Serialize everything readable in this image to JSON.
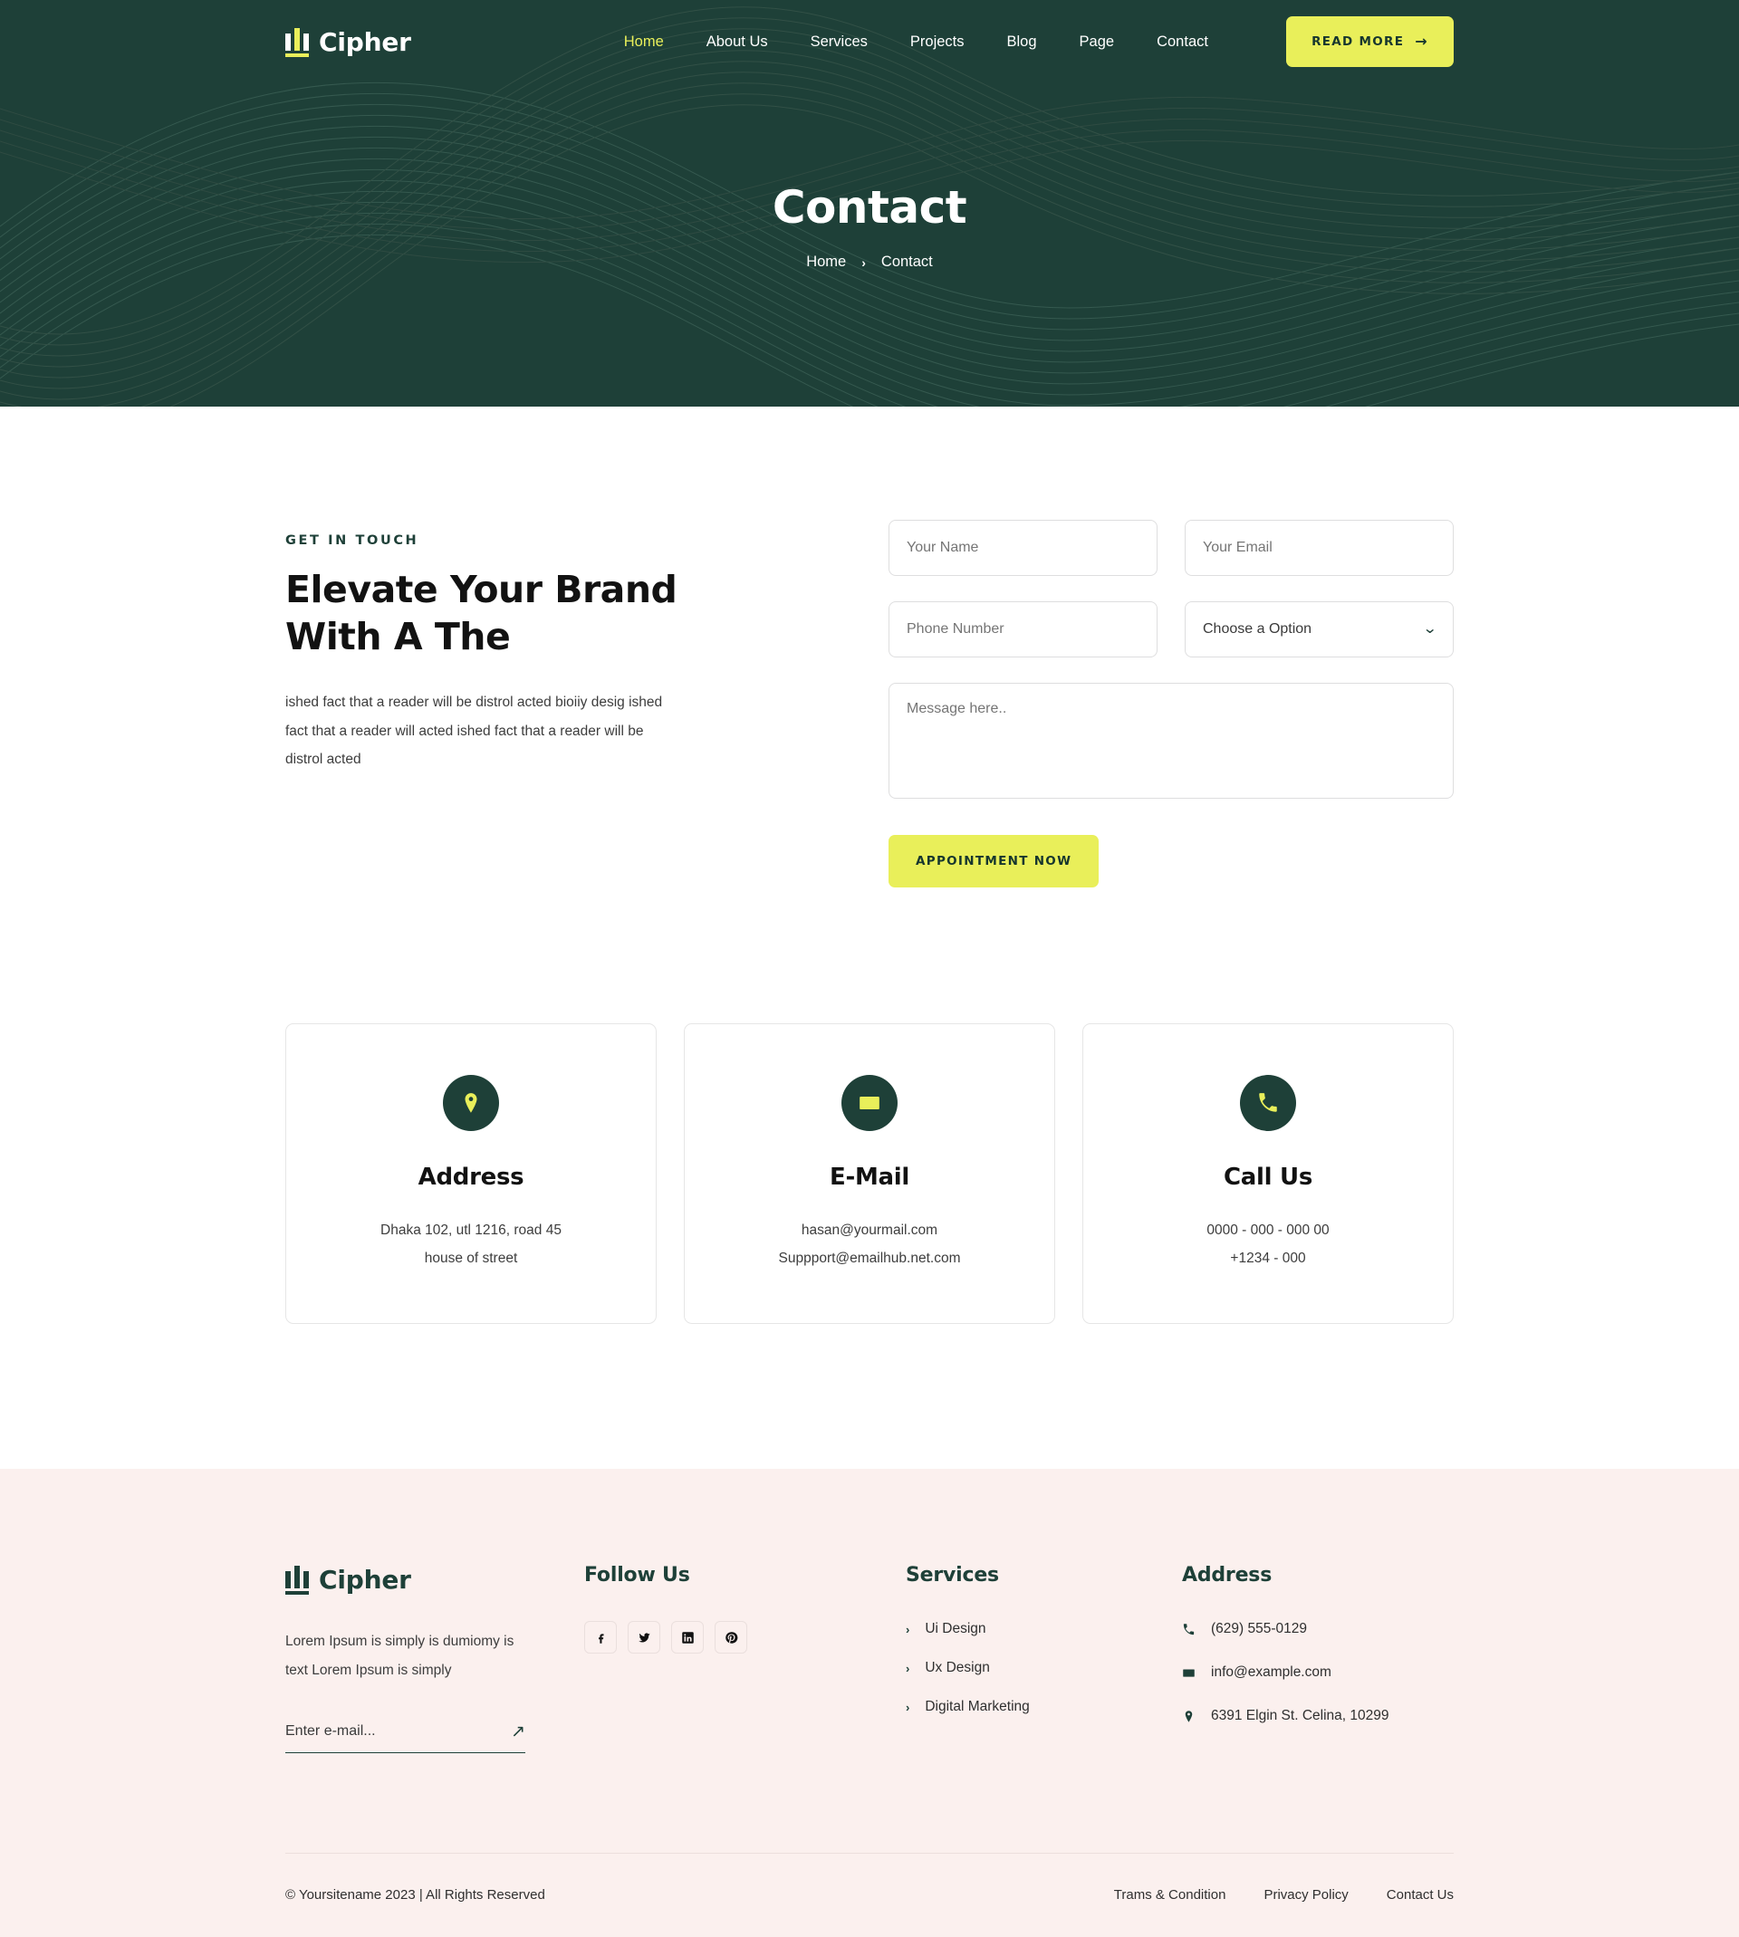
{
  "brand": {
    "name": "Cipher",
    "logo_icon": "bars-logo-icon"
  },
  "nav": {
    "items": [
      {
        "label": "Home",
        "active": true
      },
      {
        "label": "About Us",
        "active": false
      },
      {
        "label": "Services",
        "active": false
      },
      {
        "label": "Projects",
        "active": false
      },
      {
        "label": "Blog",
        "active": false
      },
      {
        "label": "Page",
        "active": false
      },
      {
        "label": "Contact",
        "active": false
      }
    ],
    "cta_label": "READ MORE",
    "cta_icon": "arrow-right-icon"
  },
  "hero": {
    "title": "Contact",
    "breadcrumb": {
      "home": "Home",
      "separator": "›",
      "current": "Contact"
    }
  },
  "contact": {
    "eyebrow": "GET IN TOUCH",
    "title_line1": "Elevate Your Brand",
    "title_line2": "With A The",
    "description": "ished fact that a reader will be distrol acted bioiiy desig ished fact that a reader will acted ished fact that a reader will be distrol acted",
    "form": {
      "name_placeholder": "Your Name",
      "email_placeholder": "Your Email",
      "phone_placeholder": "Phone Number",
      "option_label": "Choose a Option",
      "option_icon": "chevron-down-icon",
      "message_placeholder": "Message here..",
      "submit_label": "APPOINTMENT NOW"
    }
  },
  "info_cards": [
    {
      "icon": "location-pin-icon",
      "title": "Address",
      "lines": [
        "Dhaka 102, utl 1216, road 45",
        "house of street"
      ]
    },
    {
      "icon": "envelope-icon",
      "title": "E-Mail",
      "lines": [
        "hasan@yourmail.com",
        "Suppport@emailhub.net.com"
      ]
    },
    {
      "icon": "phone-icon",
      "title": "Call Us",
      "lines": [
        "0000 - 000 - 000 00",
        "+1234 - 000"
      ]
    }
  ],
  "footer": {
    "brand_name": "Cipher",
    "description": "Lorem Ipsum is simply is dumiomy is text Lorem Ipsum is simply",
    "newsletter": {
      "placeholder": "Enter e-mail...",
      "submit_icon": "arrow-up-right-icon"
    },
    "follow": {
      "title": "Follow Us",
      "socials": [
        {
          "icon": "facebook-icon",
          "name": "Facebook"
        },
        {
          "icon": "twitter-icon",
          "name": "Twitter"
        },
        {
          "icon": "linkedin-icon",
          "name": "LinkedIn"
        },
        {
          "icon": "pinterest-icon",
          "name": "Pinterest"
        }
      ]
    },
    "services": {
      "title": "Services",
      "items": [
        "Ui Design",
        "Ux Design",
        "Digital Marketing"
      ]
    },
    "address": {
      "title": "Address",
      "items": [
        {
          "icon": "phone-icon",
          "text": "(629) 555-0129"
        },
        {
          "icon": "envelope-icon",
          "text": "info@example.com"
        },
        {
          "icon": "location-pin-icon",
          "text": "6391 Elgin St. Celina, 10299"
        }
      ]
    },
    "copyright": "© Yoursitename  2023 | All Rights Reserved",
    "legal": [
      "Trams & Condition",
      "Privacy Policy",
      "Contact Us"
    ]
  },
  "colors": {
    "dark_green": "#1e4038",
    "accent_yellow": "#e9ef5a",
    "footer_bg": "#fbf0ee",
    "body_text": "#3d3d3d"
  }
}
